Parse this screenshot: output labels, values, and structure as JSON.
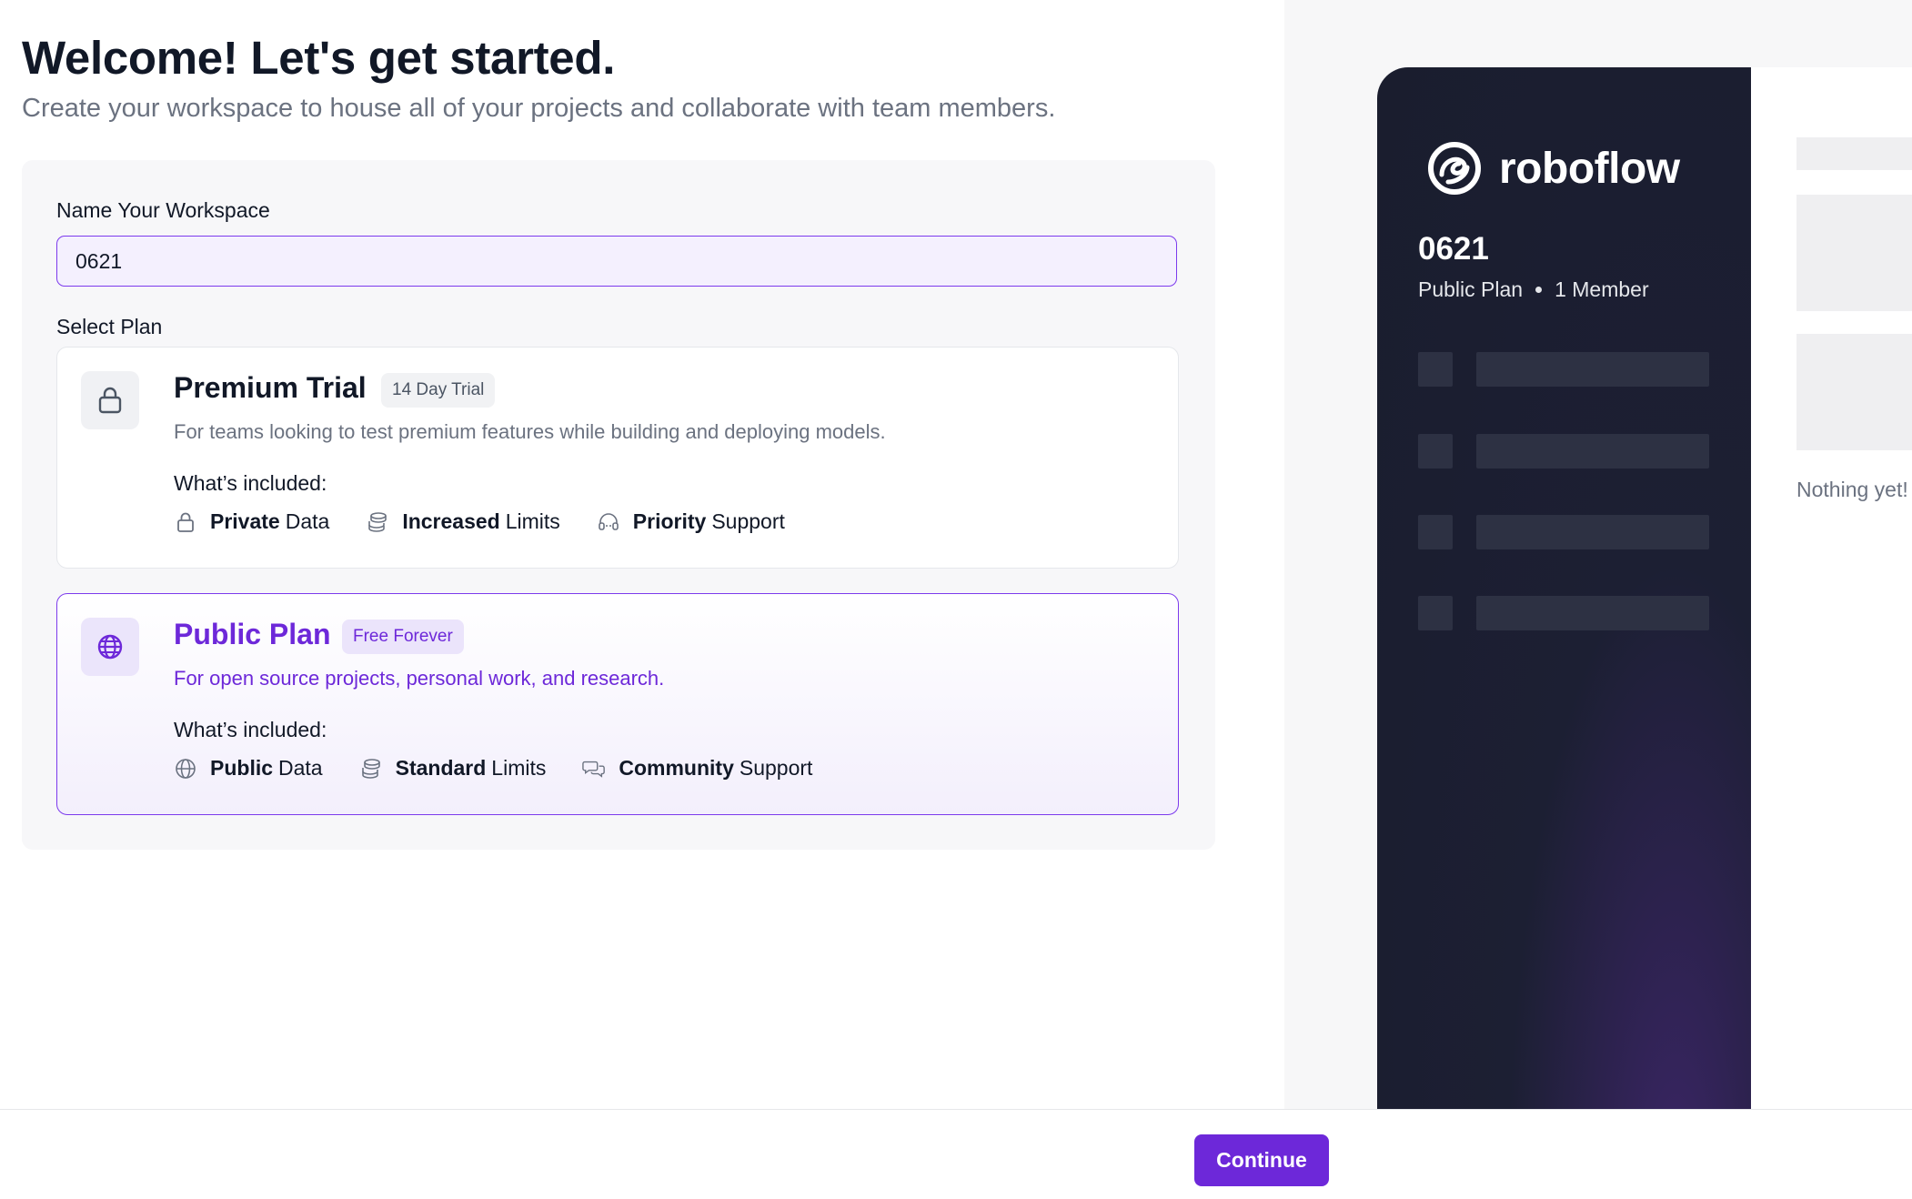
{
  "header": {
    "title": "Welcome! Let's get started.",
    "subtitle": "Create your workspace to house all of your projects and collaborate with team members."
  },
  "workspace": {
    "label": "Name Your Workspace",
    "value": "0621"
  },
  "plans": {
    "label": "Select Plan",
    "selected": "public",
    "premium": {
      "name": "Premium Trial",
      "badge": "14 Day Trial",
      "description": "For teams looking to test premium features while building and deploying models.",
      "included_label": "What’s included:",
      "features": [
        {
          "icon": "lock-icon",
          "bold": "Private",
          "rest": "Data"
        },
        {
          "icon": "coins-icon",
          "bold": "Increased",
          "rest": "Limits"
        },
        {
          "icon": "headset-icon",
          "bold": "Priority",
          "rest": "Support"
        }
      ]
    },
    "public": {
      "name": "Public Plan",
      "badge": "Free Forever",
      "description": "For open source projects, personal work, and research.",
      "included_label": "What’s included:",
      "features": [
        {
          "icon": "globe-icon",
          "bold": "Public",
          "rest": "Data"
        },
        {
          "icon": "coins-icon",
          "bold": "Standard",
          "rest": "Limits"
        },
        {
          "icon": "chat-bubbles-icon",
          "bold": "Community",
          "rest": "Support"
        }
      ]
    }
  },
  "preview": {
    "brand": "roboflow",
    "workspace_name": "0621",
    "plan": "Public Plan",
    "members": "1 Member",
    "empty_text": "Nothing yet!"
  },
  "footer": {
    "continue_label": "Continue"
  },
  "colors": {
    "accent": "#6d28d9",
    "sidebar": "#1c1f33"
  }
}
